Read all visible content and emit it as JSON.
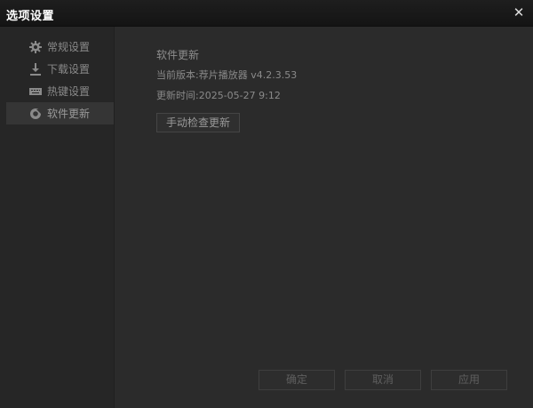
{
  "window": {
    "title": "选项设置"
  },
  "sidebar": {
    "items": [
      {
        "label": "常规设置",
        "icon": "gear-icon",
        "active": false
      },
      {
        "label": "下载设置",
        "icon": "download-icon",
        "active": false
      },
      {
        "label": "热键设置",
        "icon": "keyboard-icon",
        "active": false
      },
      {
        "label": "软件更新",
        "icon": "refresh-icon",
        "active": true
      }
    ]
  },
  "update": {
    "section_title": "软件更新",
    "version_line": "当前版本:荐片播放器 v4.2.3.53",
    "time_line": "更新时间:2025-05-27 9:12",
    "check_button": "手动检查更新"
  },
  "footer": {
    "ok": "确定",
    "cancel": "取消",
    "apply": "应用"
  },
  "colors": {
    "background": "#2b2b2b",
    "sidebar": "#262626",
    "titlebar": "#161616",
    "active_item": "#353535"
  }
}
